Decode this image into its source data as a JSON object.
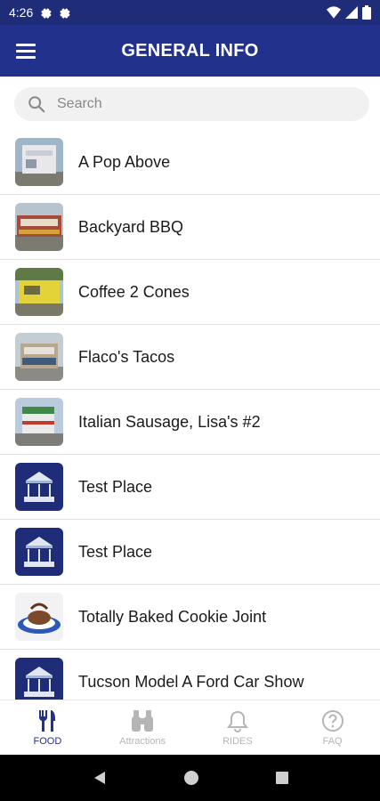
{
  "status_bar": {
    "time": "4:26"
  },
  "header": {
    "title": "GENERAL INFO"
  },
  "search": {
    "placeholder": "Search"
  },
  "items": [
    {
      "label": "A Pop Above",
      "thumb": "photo"
    },
    {
      "label": "Backyard BBQ",
      "thumb": "photo"
    },
    {
      "label": "Coffee 2 Cones",
      "thumb": "photo"
    },
    {
      "label": "Flaco's Tacos",
      "thumb": "photo"
    },
    {
      "label": "Italian Sausage, Lisa's #2",
      "thumb": "photo"
    },
    {
      "label": "Test Place",
      "thumb": "logo"
    },
    {
      "label": "Test Place",
      "thumb": "logo"
    },
    {
      "label": "Totally Baked Cookie Joint",
      "thumb": "photo"
    },
    {
      "label": "Tucson Model A Ford Car Show",
      "thumb": "logo"
    }
  ],
  "bottom_nav": [
    {
      "label": "FOOD",
      "icon": "fork-knife-icon",
      "active": true
    },
    {
      "label": "Attractions",
      "icon": "binoculars-icon",
      "active": false
    },
    {
      "label": "RIDES",
      "icon": "bell-icon",
      "active": false
    },
    {
      "label": "FAQ",
      "icon": "question-circle-icon",
      "active": false
    }
  ],
  "colors": {
    "brand": "#22318b",
    "status_bar": "#1f2d78",
    "inactive": "#b5b5b5"
  }
}
